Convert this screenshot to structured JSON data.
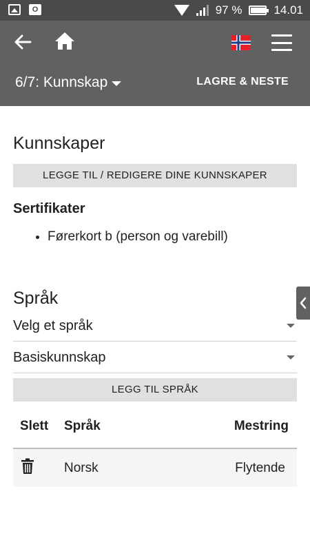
{
  "status_bar": {
    "battery_percent": "97 %",
    "time": "14.01",
    "battery_level": 0.97
  },
  "header": {
    "step_label": "6/7: Kunnskap",
    "save_next": "LAGRE & NESTE",
    "flag_colors": {
      "red": "#e4202a",
      "white": "#ffffff",
      "blue": "#1f3d8a"
    }
  },
  "skills": {
    "title": "Kunnskaper",
    "edit_button": "LEGGE TIL / REDIGERE DINE KUNNSKAPER",
    "certificates_title": "Sertifikater",
    "certificates": [
      "Førerkort b (person og varebill)"
    ]
  },
  "languages": {
    "title": "Språk",
    "language_select": "Velg et språk",
    "level_select": "Basiskunnskap",
    "add_button": "LEGG TIL SPRÅK",
    "table": {
      "headers": {
        "delete": "Slett",
        "language": "Språk",
        "level": "Mestring"
      },
      "rows": [
        {
          "language": "Norsk",
          "level": "Flytende"
        }
      ]
    }
  },
  "colors": {
    "header_bg": "#616161",
    "status_bg": "#4a4a4a",
    "button_bg": "#e0e0e0"
  }
}
